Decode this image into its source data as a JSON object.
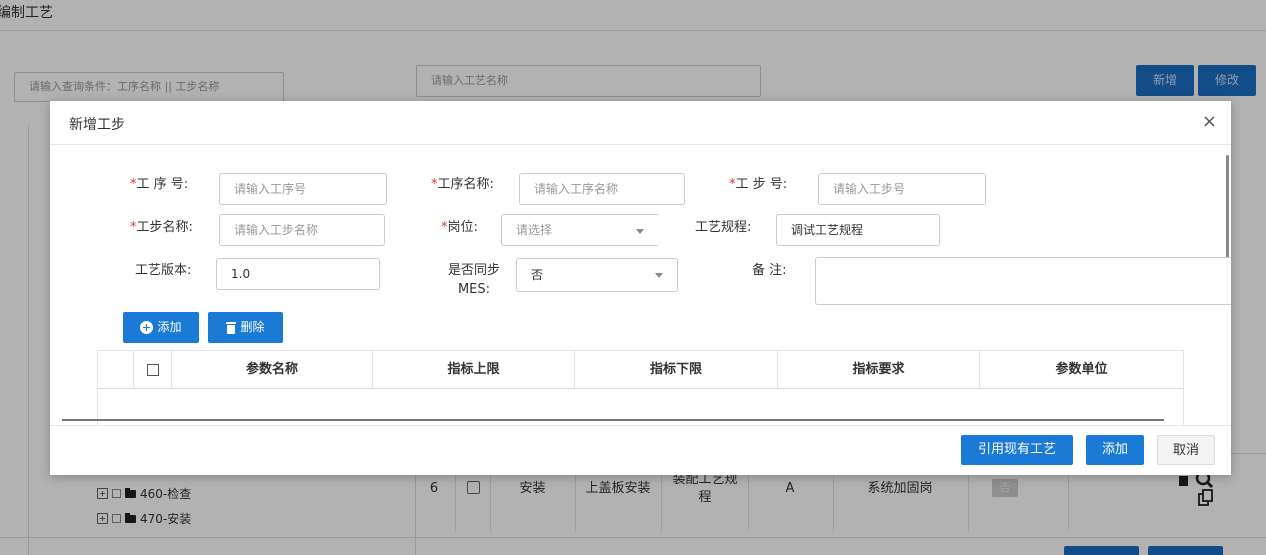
{
  "page": {
    "title": "编制工艺",
    "search_step_placeholder": "请输入查询条件：工序名称  || 工步名称",
    "search_process_placeholder": "请输入工艺名称",
    "add_label": "新增",
    "edit_label": "修改"
  },
  "tree": {
    "items": [
      {
        "label": "460-检查"
      },
      {
        "label": "470-安装"
      }
    ]
  },
  "bg_table": {
    "row": {
      "index": "6",
      "process": "安装",
      "step": "上盖板安装",
      "spec": "装配工艺规程",
      "version": "A",
      "post": "系统加固岗",
      "sync": "否"
    }
  },
  "modal": {
    "title": "新增工步",
    "close": "×",
    "fields": {
      "op_no": {
        "label": "工 序 号:",
        "placeholder": "请输入工序号"
      },
      "op_name": {
        "label": "工序名称:",
        "placeholder": "请输入工序名称"
      },
      "step_no": {
        "label": "工 步 号:",
        "placeholder": "请输入工步号"
      },
      "step_name": {
        "label": "工步名称:",
        "placeholder": "请输入工步名称"
      },
      "post": {
        "label": "岗位:",
        "placeholder": "请选择"
      },
      "spec": {
        "label": "工艺规程:",
        "value": "调试工艺规程"
      },
      "version": {
        "label": "工艺版本:",
        "value": "1.0"
      },
      "sync_mes": {
        "label_line1": "是否同步",
        "label_line2": "MES:",
        "value": "否"
      },
      "remark": {
        "label": "备 注:"
      }
    },
    "required_mark": "*",
    "toolbar": {
      "add": "添加",
      "delete": "删除"
    },
    "param_table": {
      "columns": [
        "参数名称",
        "指标上限",
        "指标下限",
        "指标要求",
        "参数单位"
      ]
    },
    "footer": {
      "reference": "引用现有工艺",
      "add": "添加",
      "cancel": "取消"
    }
  },
  "colors": {
    "primary": "#1b7ad6",
    "required": "#e5322d"
  }
}
